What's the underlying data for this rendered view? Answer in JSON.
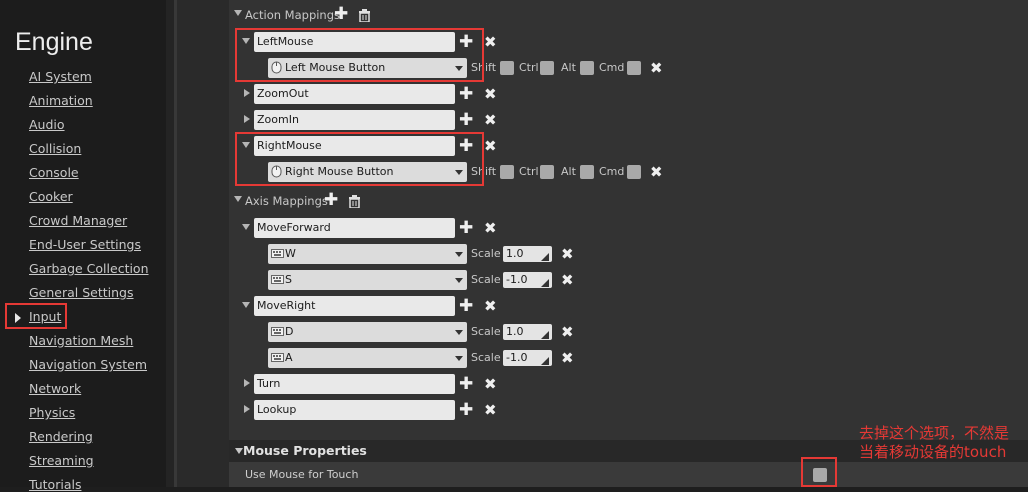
{
  "sidebar": {
    "heading": "Engine",
    "items": [
      {
        "label": "AI System"
      },
      {
        "label": "Animation"
      },
      {
        "label": "Audio"
      },
      {
        "label": "Collision"
      },
      {
        "label": "Console"
      },
      {
        "label": "Cooker"
      },
      {
        "label": "Crowd Manager"
      },
      {
        "label": "End-User Settings"
      },
      {
        "label": "Garbage Collection"
      },
      {
        "label": "General Settings"
      },
      {
        "label": "Input"
      },
      {
        "label": "Navigation Mesh"
      },
      {
        "label": "Navigation System"
      },
      {
        "label": "Network"
      },
      {
        "label": "Physics"
      },
      {
        "label": "Rendering"
      },
      {
        "label": "Streaming"
      },
      {
        "label": "Tutorials"
      }
    ],
    "selected": "Input"
  },
  "action_mappings": {
    "label": "Action Mappings",
    "items": [
      {
        "name": "LeftMouse",
        "key": "Left Mouse Button",
        "expanded": true
      },
      {
        "name": "ZoomOut",
        "expanded": false
      },
      {
        "name": "ZoomIn",
        "expanded": false
      },
      {
        "name": "RightMouse",
        "key": "Right Mouse Button",
        "expanded": true
      }
    ],
    "modifiers": [
      "Shift",
      "Ctrl",
      "Alt",
      "Cmd"
    ]
  },
  "axis_mappings": {
    "label": "Axis Mappings",
    "items": [
      {
        "name": "MoveForward",
        "keys": [
          {
            "key": "W",
            "scale": "1.0"
          },
          {
            "key": "S",
            "scale": "-1.0"
          }
        ]
      },
      {
        "name": "MoveRight",
        "keys": [
          {
            "key": "D",
            "scale": "1.0"
          },
          {
            "key": "A",
            "scale": "-1.0"
          }
        ]
      },
      {
        "name": "Turn"
      },
      {
        "name": "Lookup"
      }
    ],
    "scale_label": "Scale"
  },
  "mouse_properties": {
    "title": "Mouse Properties",
    "use_mouse_for_touch": "Use Mouse for Touch",
    "use_mouse_for_touch_checked": false
  },
  "annotation": {
    "line1": "去掉这个选项，不然是",
    "line2": "当着移动设备的touch",
    "color": "#e53935"
  },
  "colors": {
    "highlight": "#e53935",
    "panel": "#333333"
  }
}
